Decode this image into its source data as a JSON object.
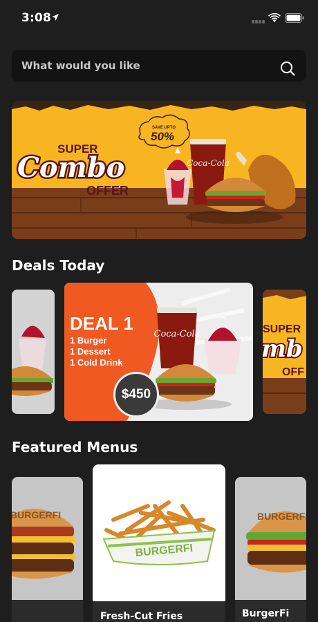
{
  "status_bar": {
    "time": "3:08"
  },
  "search": {
    "placeholder": "What would you like"
  },
  "hero_banner": {
    "save_label": "SAVE UPTO",
    "save_value": "50%",
    "line1": "SUPER",
    "line2": "Combo",
    "line3": "OFFER",
    "cup_brand": "Coca-Cola"
  },
  "deals": {
    "title": "Deals Today",
    "main": {
      "title": "DEAL 1",
      "items": [
        "1 Burger",
        "1 Dessert",
        "1 Cold Drink"
      ],
      "price": "$450",
      "cup_brand": "Coca-Cola"
    },
    "right_peek": {
      "line1": "SUPER",
      "line2": "mb",
      "line3": "OFF"
    }
  },
  "featured": {
    "title": "Featured Menus",
    "items": [
      {
        "name": "",
        "brand": "BURGERFI"
      },
      {
        "name": "Fresh-Cut Fries",
        "brand": "BURGERFI"
      },
      {
        "name": "BurgerFi",
        "brand": "BURGERFI"
      }
    ]
  },
  "colors": {
    "background": "#1e1e1e",
    "search_bg": "#131313",
    "banner_yellow": "#f7b521",
    "deal_orange": "#f05a22",
    "combo_maroon": "#5a1414"
  }
}
